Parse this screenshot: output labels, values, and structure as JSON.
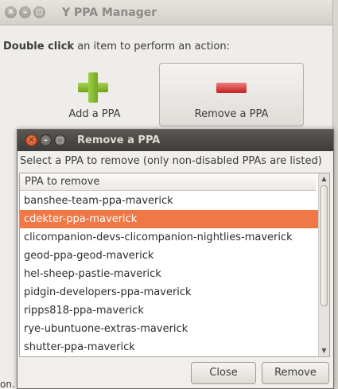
{
  "main_window": {
    "title": "Y PPA Manager",
    "instruction_bold": "Double click",
    "instruction_rest": " an item to perform an action:",
    "actions": [
      {
        "label": "Add a PPA",
        "icon": "plus-icon"
      },
      {
        "label": "Remove a PPA",
        "icon": "minus-icon"
      }
    ],
    "background_fragment": "on."
  },
  "dialog": {
    "title": "Remove a PPA",
    "instruction": "Select a PPA to remove (only non-disabled PPAs are listed)",
    "column_header": "PPA to remove",
    "items": [
      "banshee-team-ppa-maverick",
      "cdekter-ppa-maverick",
      "clicompanion-devs-clicompanion-nightlies-maverick",
      "geod-ppa-geod-maverick",
      "hel-sheep-pastie-maverick",
      "pidgin-developers-ppa-maverick",
      "ripps818-ppa-maverick",
      "rye-ubuntuone-extras-maverick",
      "shutter-ppa-maverick"
    ],
    "selected_item": "cdekter-ppa-maverick",
    "buttons": {
      "close": "Close",
      "remove": "Remove"
    }
  },
  "colors": {
    "selection": "#f07746",
    "dialog_titlebar": "#3e3d39",
    "add_icon": "#7db02a",
    "remove_icon": "#d0302e"
  }
}
